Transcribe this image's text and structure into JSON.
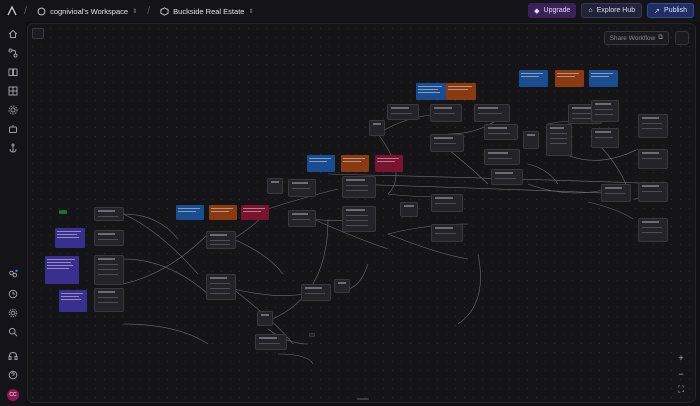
{
  "header": {
    "workspace": "cognivioal's Workspace",
    "project": "Buckside Real Estate",
    "upgrade_label": "Upgrade",
    "explore_label": "Explore Hub",
    "publish_label": "Publish"
  },
  "canvas": {
    "share_label": "Share Workflow"
  },
  "user": {
    "initials": "CC"
  },
  "colors": {
    "accent_purple": "#3a2156",
    "note_blue": "#1a4d8f",
    "note_orange": "#8a3a10",
    "note_red": "#7a1232",
    "note_violet": "#3a2f8f",
    "note_green": "#1e6b3c",
    "node": "#242428",
    "edge": "#8a8a92"
  },
  "sidebar_icons": [
    "home-icon",
    "flows-icon",
    "book-icon",
    "grid-icon",
    "settings-icon",
    "bot-icon",
    "anchor-icon",
    "team-icon",
    "history-icon",
    "gear-icon",
    "search-icon",
    "headset-icon",
    "help-icon"
  ]
}
